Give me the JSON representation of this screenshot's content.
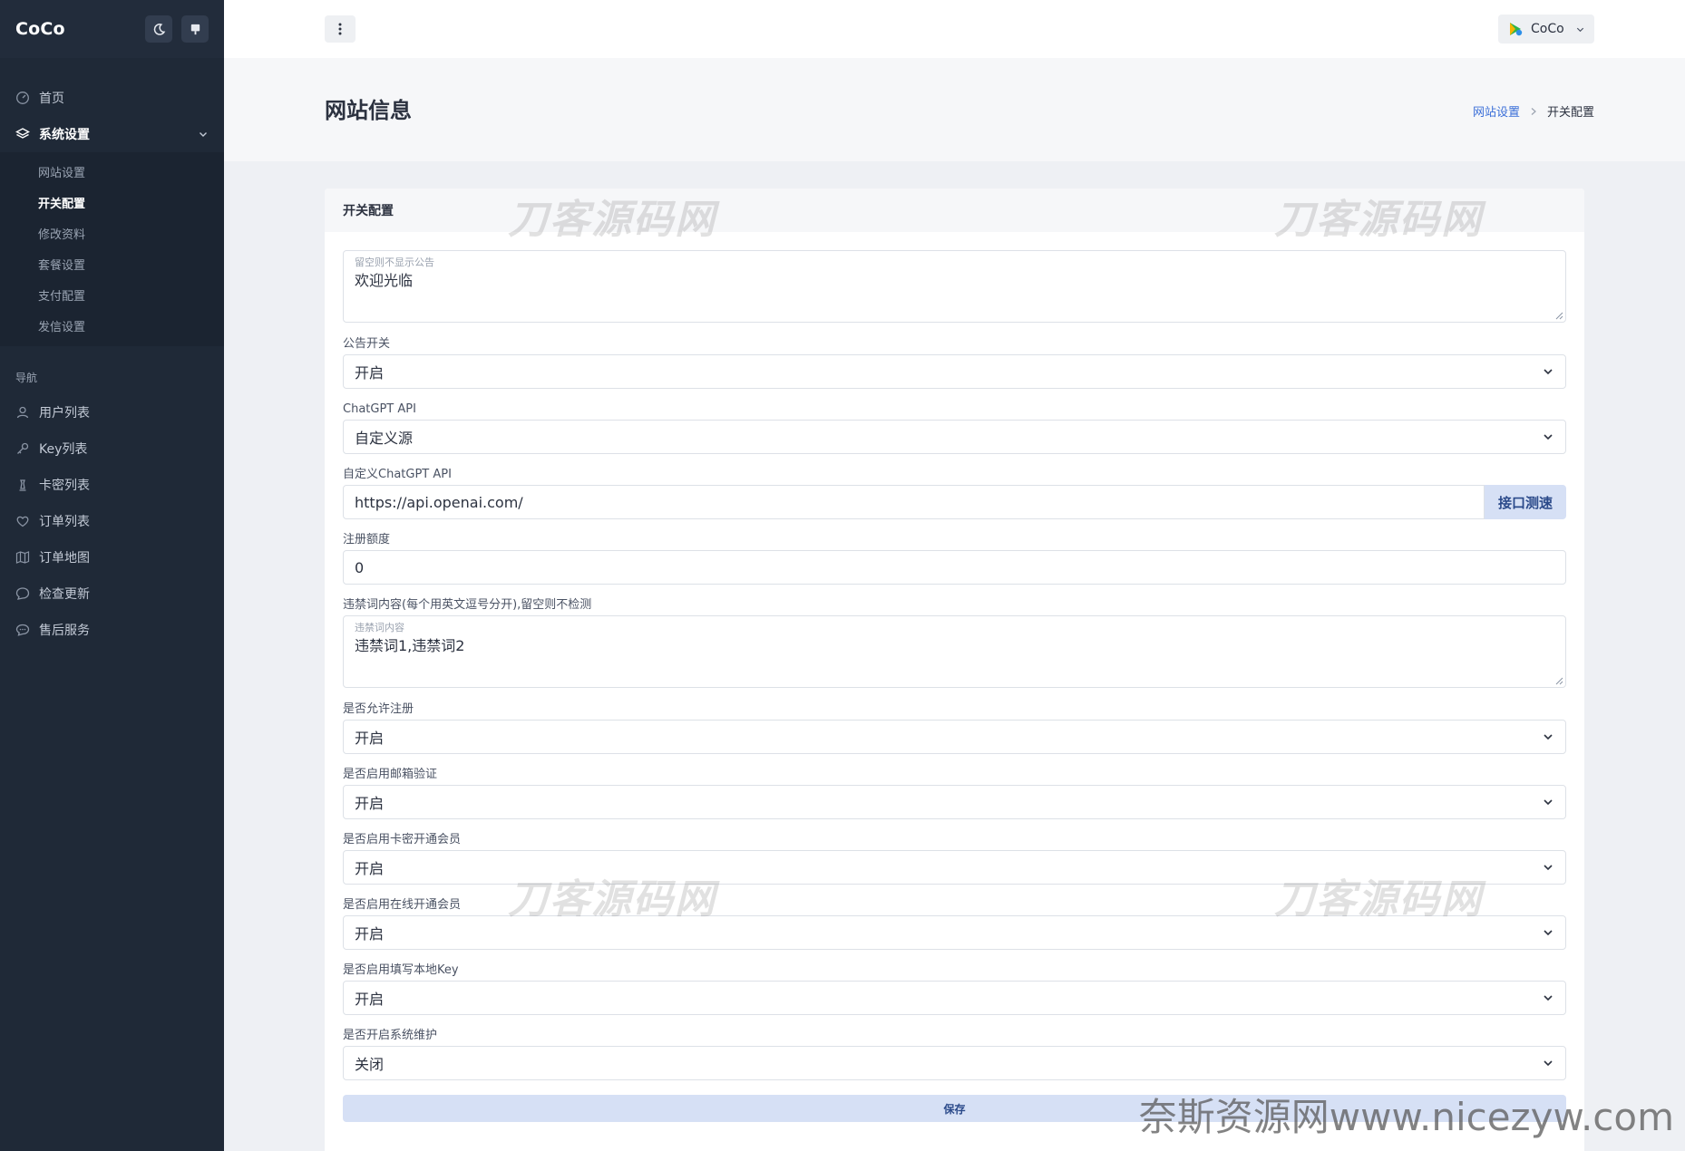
{
  "sidebar": {
    "brand": "CoCo",
    "items": {
      "home": "首页",
      "system_settings": "系统设置",
      "nav_heading": "导航",
      "user_list": "用户列表",
      "key_list": "Key列表",
      "card_list": "卡密列表",
      "order_list": "订单列表",
      "order_map": "订单地图",
      "check_update": "检查更新",
      "after_sales": "售后服务"
    },
    "submenu": {
      "site_settings": "网站设置",
      "switch_config": "开关配置",
      "edit_profile": "修改资料",
      "plan_settings": "套餐设置",
      "payment_config": "支付配置",
      "mail_settings": "发信设置"
    }
  },
  "topbar": {
    "username": "CoCo"
  },
  "page": {
    "title": "网站信息",
    "breadcrumb_parent": "网站设置",
    "breadcrumb_current": "开关配置"
  },
  "card": {
    "title": "开关配置",
    "announcement": {
      "placeholder": "留空则不显示公告",
      "value": "欢迎光临"
    },
    "announcement_switch": {
      "label": "公告开关",
      "value": "开启"
    },
    "chatgpt_api": {
      "label": "ChatGPT API",
      "value": "自定义源"
    },
    "custom_api": {
      "label": "自定义ChatGPT API",
      "value": "https://api.openai.com/",
      "test_button": "接口测速"
    },
    "register_quota": {
      "label": "注册额度",
      "value": "0"
    },
    "banned_words_label": "违禁词内容(每个用英文逗号分开),留空则不检测",
    "banned_words": {
      "placeholder": "违禁词内容",
      "value": "违禁词1,违禁词2"
    },
    "allow_register": {
      "label": "是否允许注册",
      "value": "开启"
    },
    "email_verify": {
      "label": "是否启用邮箱验证",
      "value": "开启"
    },
    "card_membership": {
      "label": "是否启用卡密开通会员",
      "value": "开启"
    },
    "online_membership": {
      "label": "是否启用在线开通会员",
      "value": "开启"
    },
    "local_key": {
      "label": "是否启用填写本地Key",
      "value": "开启"
    },
    "maintenance": {
      "label": "是否开启系统维护",
      "value": "关闭"
    },
    "save_button": "保存"
  },
  "watermarks": {
    "text": "刀客源码网",
    "corner": "奈斯资源网www.nicezyw.com"
  },
  "colors": {
    "sidebar_bg": "#1f2937",
    "accent": "#3b6fd8",
    "button_bg": "#d6e0f5"
  }
}
